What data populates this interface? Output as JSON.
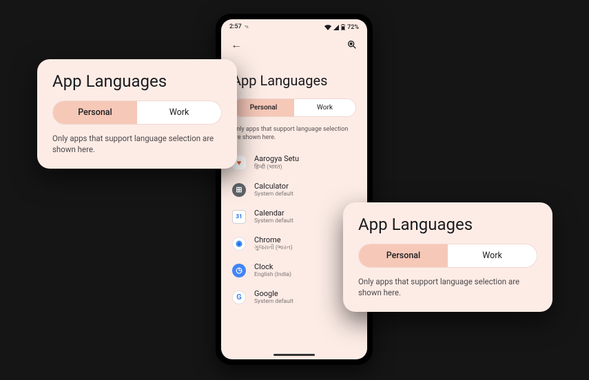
{
  "phone": {
    "status": {
      "time": "2:57",
      "tz": "ฯเ",
      "battery": "72%"
    },
    "title": "App Languages",
    "tabs": {
      "personal": "Personal",
      "work": "Work"
    },
    "helper": "Only apps that support language selection are shown here.",
    "apps": [
      {
        "name": "Aarogya Setu",
        "sub": "हिन्दी (भारत)"
      },
      {
        "name": "Calculator",
        "sub": "System default"
      },
      {
        "name": "Calendar",
        "sub": "System default"
      },
      {
        "name": "Chrome",
        "sub": "ગુજરાતી (ભારત)"
      },
      {
        "name": "Clock",
        "sub": "English (India)"
      },
      {
        "name": "Google",
        "sub": "System default"
      }
    ]
  },
  "card_left": {
    "title": "App Languages",
    "tabs": {
      "personal": "Personal",
      "work": "Work"
    },
    "helper": "Only apps that support language selection are shown here."
  },
  "card_right": {
    "title": "App Languages",
    "tabs": {
      "personal": "Personal",
      "work": "Work"
    },
    "helper": "Only apps that support language selection are shown here."
  },
  "icons": {
    "aarogya": {
      "glyph": "♥",
      "bg": "#ffffff",
      "fg": "#e85d38",
      "radius": "6px"
    },
    "calculator": {
      "glyph": "⊞",
      "bg": "#5f6368",
      "fg": "#fff"
    },
    "calendar": {
      "glyph": "31",
      "bg": "#ffffff",
      "fg": "#1a73e8",
      "radius": "4px",
      "border": "1px solid #d0d0d0",
      "fs": "8px"
    },
    "chrome": {
      "glyph": "◉",
      "bg": "#ffffff",
      "fg": "#1a73e8",
      "border": "1px solid #e0e0e0"
    },
    "clock": {
      "glyph": "◷",
      "bg": "#4285f4",
      "fg": "#fff"
    },
    "google": {
      "glyph": "G",
      "bg": "#ffffff",
      "fg": "#4285f4",
      "border": "1px solid #e0e0e0"
    }
  }
}
